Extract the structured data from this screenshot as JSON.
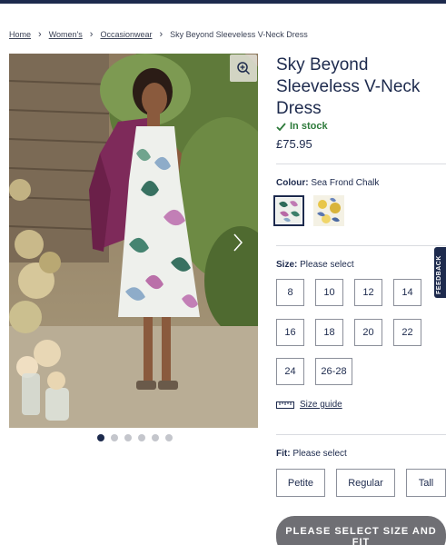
{
  "breadcrumb": {
    "items": [
      "Home",
      "Women's",
      "Occasionwear"
    ],
    "current": "Sky Beyond Sleeveless V-Neck Dress"
  },
  "product": {
    "title": "Sky Beyond Sleeveless V-Neck Dress",
    "stock": "In stock",
    "price": "£75.95"
  },
  "gallery": {
    "dot_count": 6,
    "active_index": 0,
    "icons": [
      "zoom-in-icon",
      "chevron-right-icon"
    ]
  },
  "colour": {
    "label": "Colour:",
    "selected": "Sea Frond Chalk",
    "swatches": [
      "Sea Frond Chalk",
      "Yellow Floral"
    ]
  },
  "size": {
    "label": "Size:",
    "prompt": "Please select",
    "options": [
      "8",
      "10",
      "12",
      "14",
      "16",
      "18",
      "20",
      "22",
      "24",
      "26-28"
    ],
    "guide_label": "Size guide"
  },
  "fit": {
    "label": "Fit:",
    "prompt": "Please select",
    "options": [
      "Petite",
      "Regular",
      "Tall"
    ]
  },
  "cta": {
    "label": "PLEASE SELECT SIZE AND FIT"
  },
  "feedback": {
    "label": "FEEDBACK"
  },
  "colors": {
    "navy": "#1d2a4d",
    "stock_green": "#2d7a3a",
    "cta_grey": "#6f6f74"
  }
}
